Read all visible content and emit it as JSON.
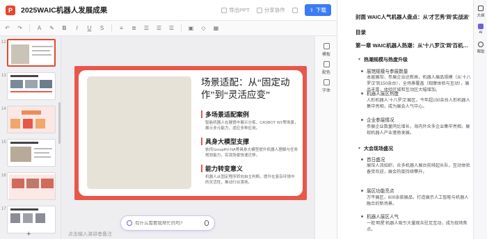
{
  "app": {
    "logo_letter": "P",
    "doc_title": "2025WAIC机器人发展成果",
    "accent": "#e8452f"
  },
  "titlebar": {
    "btn1": "导出PPT",
    "btn2": "分享协作",
    "btn3": "",
    "export": "下载"
  },
  "canvas": {
    "slide_title": "场景适配：从“固定动作”到“灵活应变”",
    "sections": [
      {
        "heading": "多场景适配案例",
        "text": "智能机器人在展馆中展示分拣、CASBOT W1等场景，展示多元能力，适应多种应用。"
      },
      {
        "heading": "具身大模型支撑",
        "text": "依托GroupRV-NA等具身大模型提升机器人理解与任务规划能力，实现场景快速迁移。"
      },
      {
        "heading": "能力转变意义",
        "text": "机器人从固定程序转向自主判断，提升在复杂环境中的灵活性，推动行业落地。"
      }
    ],
    "notes_hint": "点击输入演讲者备注",
    "ai_placeholder": "有什么需要我帮忙的吗?"
  },
  "tools": [
    "模板",
    "配色",
    "字体"
  ],
  "thumbnails": [
    "12",
    "13",
    "14",
    "15",
    "16",
    "17"
  ],
  "outline": {
    "items": [
      {
        "kind": "h1",
        "text": "封面 WAIC人气机器人盘点：从'才艺秀'到'实战派'"
      },
      {
        "kind": "h1",
        "text": "目录"
      },
      {
        "kind": "h1",
        "text": "第一章 WAIC机器人热潮：从'十八罗汉'到'百机争鸣'"
      },
      {
        "kind": "h2",
        "text": "热潮规模与热度升级"
      },
      {
        "kind": "h3",
        "text": "展馆规模与参展数量"
      },
      {
        "kind": "p",
        "text": "本届展馆、参展企业达新高，机器人展品规模（从'十八罗汉'到150余台），全场景覆盖（观摩体验与互动），展品丰富，体验区域和互动区大幅增加。"
      },
      {
        "kind": "h3",
        "text": "机器人展区热度"
      },
      {
        "kind": "p",
        "text": "人形机器人'十八罗汉'展区，今年超150余台人形机器人集中亮相，成为展会人气中心。"
      },
      {
        "kind": "h3",
        "text": "企业参展情况"
      },
      {
        "kind": "p",
        "text": "参展企业数量同比增长，海内外众多企业集中亮相，展现机器人产业蓬勃发展。"
      },
      {
        "kind": "h2",
        "text": "大会现场盛况"
      },
      {
        "kind": "h3",
        "text": "首日盛况"
      },
      {
        "kind": "p",
        "text": "展馆人流如织，众多机器人展台前排起长队，互动体验备受欢迎，展会热度持续攀升。"
      },
      {
        "kind": "h3",
        "text": "展区功能亮点"
      },
      {
        "kind": "p",
        "text": "万平展区，600余款展品，打造展示人工智能与机器人融合的新场景。"
      },
      {
        "kind": "h3",
        "text": "机器人展区人气"
      },
      {
        "kind": "p",
        "text": "一批'明星'机器人吸引大量观众驻足互动，成为现场焦点。"
      }
    ]
  },
  "rail": [
    "大纲",
    "AI",
    "帮助"
  ]
}
